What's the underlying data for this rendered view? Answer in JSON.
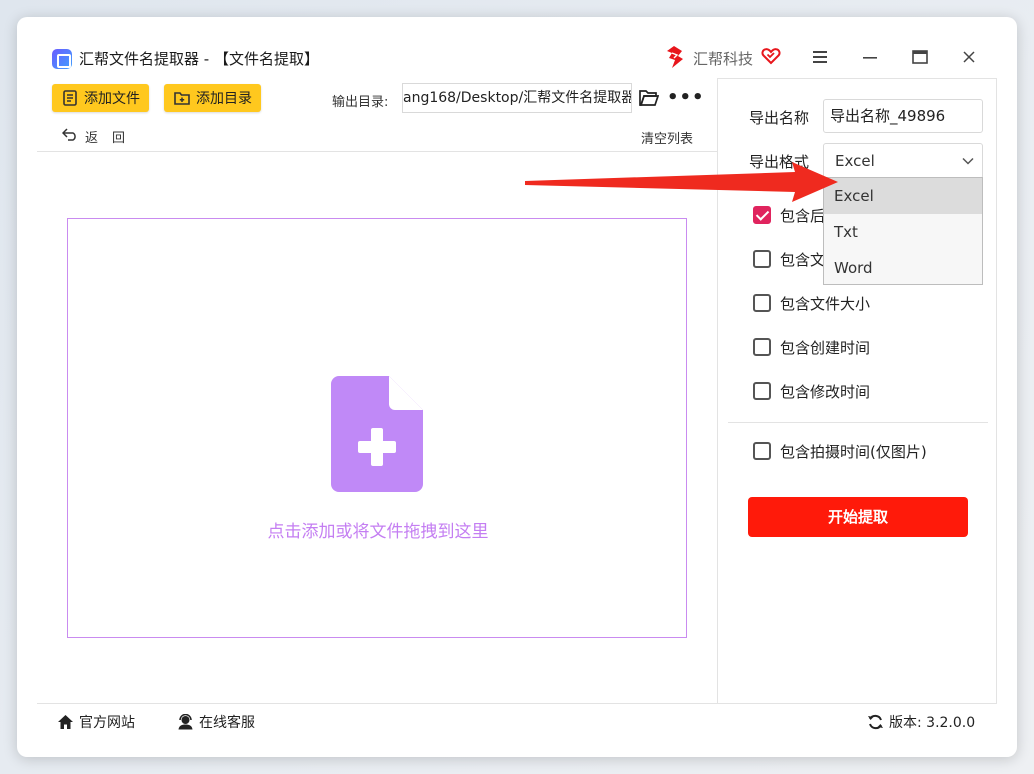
{
  "window": {
    "title": "汇帮文件名提取器 - 【文件名提取】",
    "brand_name": "汇帮科技"
  },
  "toolbar": {
    "add_file_label": "添加文件",
    "add_dir_label": "添加目录",
    "output_dir_label": "输出目录:",
    "output_dir_value": "ang168/Desktop/汇帮文件名提取器",
    "more_label": "•••",
    "back_label": "返回",
    "clear_list_label": "清空列表"
  },
  "dropzone": {
    "hint": "点击添加或将文件拖拽到这里"
  },
  "settings": {
    "export_name_label": "导出名称",
    "export_name_value": "导出名称_49896",
    "export_format_label": "导出格式",
    "export_format_value": "Excel",
    "format_options": [
      "Excel",
      "Txt",
      "Word"
    ],
    "options": [
      {
        "label": "包含后缀",
        "checked": true
      },
      {
        "label": "包含文件路径",
        "checked": false
      },
      {
        "label": "包含文件大小",
        "checked": false
      },
      {
        "label": "包含创建时间",
        "checked": false
      },
      {
        "label": "包含修改时间",
        "checked": false
      }
    ],
    "photo_option": {
      "label": "包含拍摄时间(仅图片)",
      "checked": false
    },
    "start_label": "开始提取"
  },
  "footer": {
    "site_label": "官方网站",
    "service_label": "在线客服",
    "version_label": "版本: 3.2.0.0"
  },
  "colors": {
    "accent_yellow": "#ffc81e",
    "drop_purple": "#c47ef2",
    "start_red": "#ff1a0a",
    "check_pink": "#e0245e",
    "arrow_red": "#ef2a1f"
  }
}
